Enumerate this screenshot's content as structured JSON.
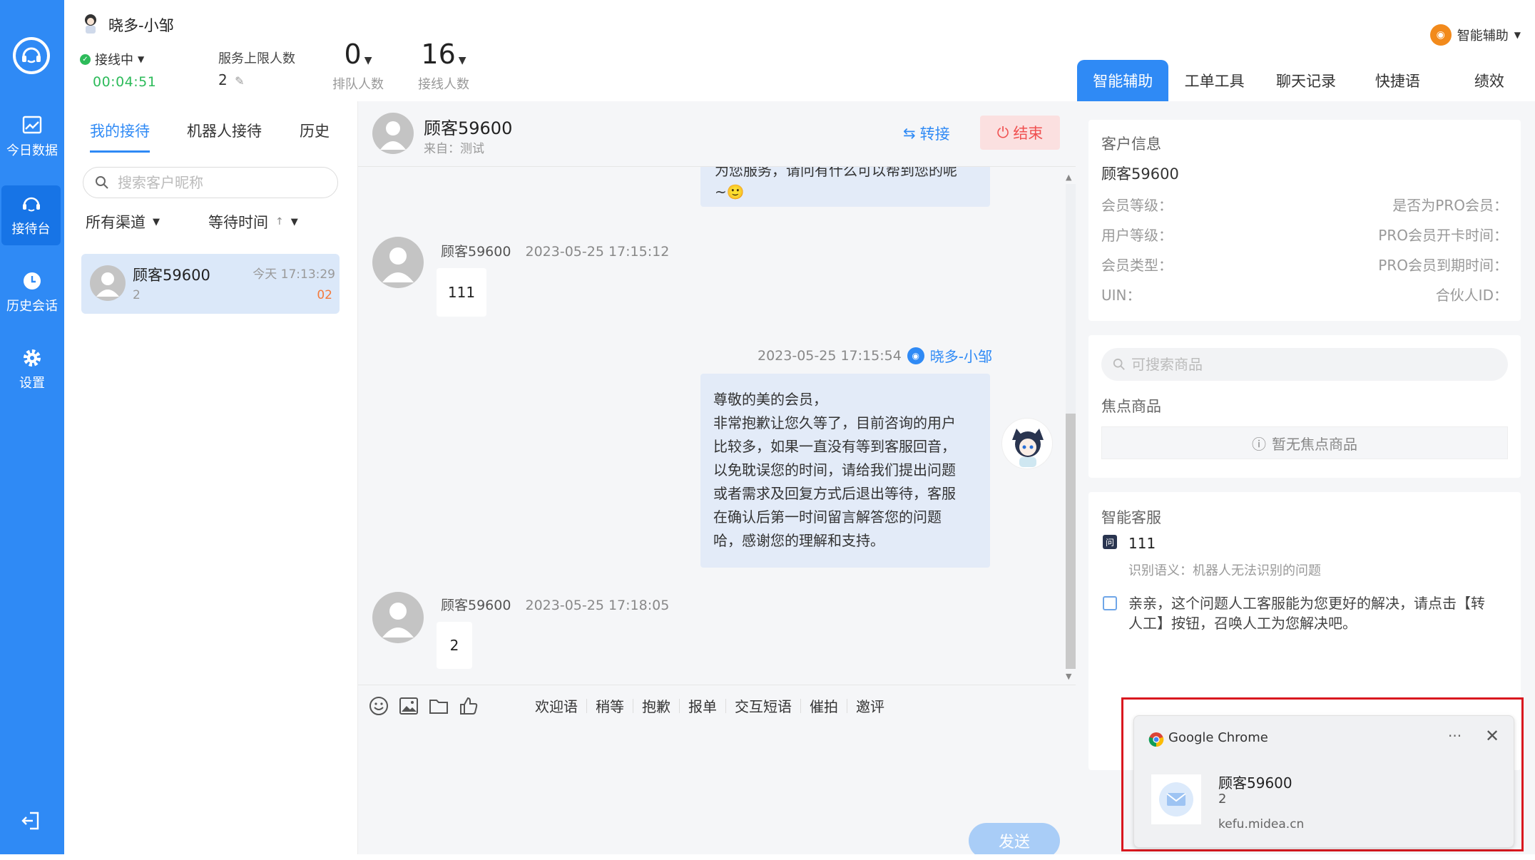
{
  "rail": {
    "items": [
      {
        "label": "今日数据",
        "icon": "chart-icon"
      },
      {
        "label": "接待台",
        "icon": "headset-icon"
      },
      {
        "label": "历史会话",
        "icon": "clock-icon"
      },
      {
        "label": "设置",
        "icon": "gear-icon"
      }
    ],
    "active_index": 1
  },
  "header": {
    "agent_name": "晓多-小邹",
    "status_label": "接线中",
    "timer": "00:04:51",
    "limit_label": "服务上限人数",
    "limit_value": "2",
    "queue_count": "0",
    "queue_label": "排队人数",
    "served_count": "16",
    "served_label": "接线人数",
    "assist_label": "智能辅助"
  },
  "right_tabs": [
    "智能辅助",
    "工单工具",
    "聊天记录",
    "快捷语",
    "绩效"
  ],
  "sessions": {
    "tabs": [
      "我的接待",
      "机器人接待",
      "历史"
    ],
    "search_placeholder": "搜索客户昵称",
    "filter_channel": "所有渠道",
    "filter_wait": "等待时间",
    "items": [
      {
        "name": "顾客59600",
        "count": "2",
        "time": "今天 17:13:29",
        "badge": "02"
      }
    ]
  },
  "chat": {
    "customer_name": "顾客59600",
    "source": "来自：测试",
    "transfer_label": "转接",
    "end_label": "结束",
    "top_bubble": {
      "line1": "为您服务，请问有什么可以帮到您的呢",
      "line2": "~🙂"
    },
    "messages": [
      {
        "who": "顾客59600",
        "time": "2023-05-25 17:15:12",
        "text": "111"
      },
      {
        "who": "顾客59600",
        "time": "2023-05-25 17:18:05",
        "text": "2"
      }
    ],
    "agent_message": {
      "time": "2023-05-25 17:15:54",
      "who": "晓多-小邹",
      "lines": [
        "尊敬的美的会员，",
        "非常抱歉让您久等了，目前咨询的用户",
        "比较多，如果一直没有等到客服回音，",
        "以免耽误您的时间，请给我们提出问题",
        "或者需求及回复方式后退出等待，客服",
        "在确认后第一时间留言解答您的问题",
        "哈，感谢您的理解和支持。"
      ]
    },
    "quick_replies": [
      "欢迎语",
      "稍等",
      "抱歉",
      "报单",
      "交互短语",
      "催拍",
      "邀评"
    ],
    "send_label": "发送"
  },
  "rpanel": {
    "customer_info_title": "客户信息",
    "customer_name": "顾客59600",
    "fields_left": [
      "会员等级：",
      "用户等级：",
      "会员类型：",
      "UIN："
    ],
    "fields_right": [
      "是否为PRO会员：",
      "PRO会员开卡时间：",
      "PRO会员到期时间：",
      "合伙人ID："
    ],
    "product_search_placeholder": "可搜索商品",
    "focus_title": "焦点商品",
    "focus_empty": "暂无焦点商品",
    "smart_title": "智能客服",
    "smart_question": "111",
    "smart_semantic": "识别语义：机器人无法识别的问题",
    "smart_answer_line1": "亲亲，这个问题人工客服能为您更好的解决，请点击【转",
    "smart_answer_line2": "人工】按钮，召唤人工为您解决吧。"
  },
  "notification": {
    "app": "Google Chrome",
    "title": "顾客59600",
    "body": "2",
    "site": "kefu.midea.cn"
  },
  "colors": {
    "brand": "#2f8af5",
    "online": "#2dbb5a",
    "danger": "#f05050",
    "highlight_frame": "#d9181f"
  }
}
